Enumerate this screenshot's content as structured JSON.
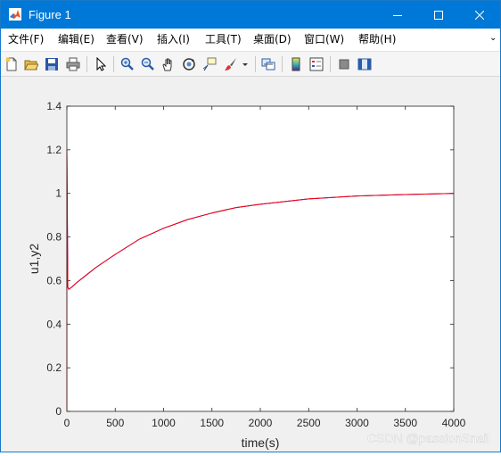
{
  "window": {
    "title": "Figure 1"
  },
  "menu": [
    "文件(F)",
    "编辑(E)",
    "查看(V)",
    "插入(I)",
    "工具(T)",
    "桌面(D)",
    "窗口(W)",
    "帮助(H)"
  ],
  "menu_overflow": "⌄",
  "toolbar": {
    "icons": [
      "new-figure-icon",
      "open-file-icon",
      "save-icon",
      "print-icon",
      "edit-plot-pointer-icon",
      "zoom-in-icon",
      "zoom-out-icon",
      "pan-hand-icon",
      "rotate-3d-icon",
      "data-cursor-icon",
      "brush-icon",
      "link-plot-icon",
      "colorbar-icon",
      "legend-icon",
      "hide-plot-tools-icon",
      "show-plot-tools-icon"
    ]
  },
  "watermark": "CSDN @passionSnail",
  "chart_data": {
    "type": "line",
    "title": "",
    "xlabel": "time(s)",
    "ylabel": "u1,y2",
    "xlim": [
      0,
      4000
    ],
    "ylim": [
      0,
      1.4
    ],
    "xticks": [
      "0",
      "500",
      "1000",
      "1500",
      "2000",
      "2500",
      "3000",
      "3500",
      "4000"
    ],
    "yticks": [
      "0",
      "0.2",
      "0.4",
      "0.6",
      "0.8",
      "1",
      "1.2",
      "1.4"
    ],
    "grid": false,
    "legend": "none",
    "series": [
      {
        "color": "#0000ff",
        "x": [
          0,
          0,
          10,
          20,
          50,
          100,
          200,
          300,
          500,
          750,
          1000,
          1250,
          1500,
          1750,
          2000,
          2500,
          3000,
          3500,
          4000
        ],
        "y": [
          0,
          1.2,
          0.57,
          0.56,
          0.57,
          0.59,
          0.625,
          0.66,
          0.72,
          0.79,
          0.84,
          0.88,
          0.91,
          0.935,
          0.95,
          0.975,
          0.988,
          0.995,
          1.0
        ]
      },
      {
        "color": "#ff0000",
        "x": [
          0,
          0,
          10,
          20,
          50,
          100,
          200,
          300,
          500,
          750,
          1000,
          1250,
          1500,
          1750,
          2000,
          2500,
          3000,
          3500,
          4000
        ],
        "y": [
          0,
          1.2,
          0.57,
          0.56,
          0.57,
          0.59,
          0.625,
          0.66,
          0.72,
          0.79,
          0.84,
          0.88,
          0.91,
          0.935,
          0.95,
          0.975,
          0.988,
          0.995,
          1.0
        ]
      }
    ]
  }
}
